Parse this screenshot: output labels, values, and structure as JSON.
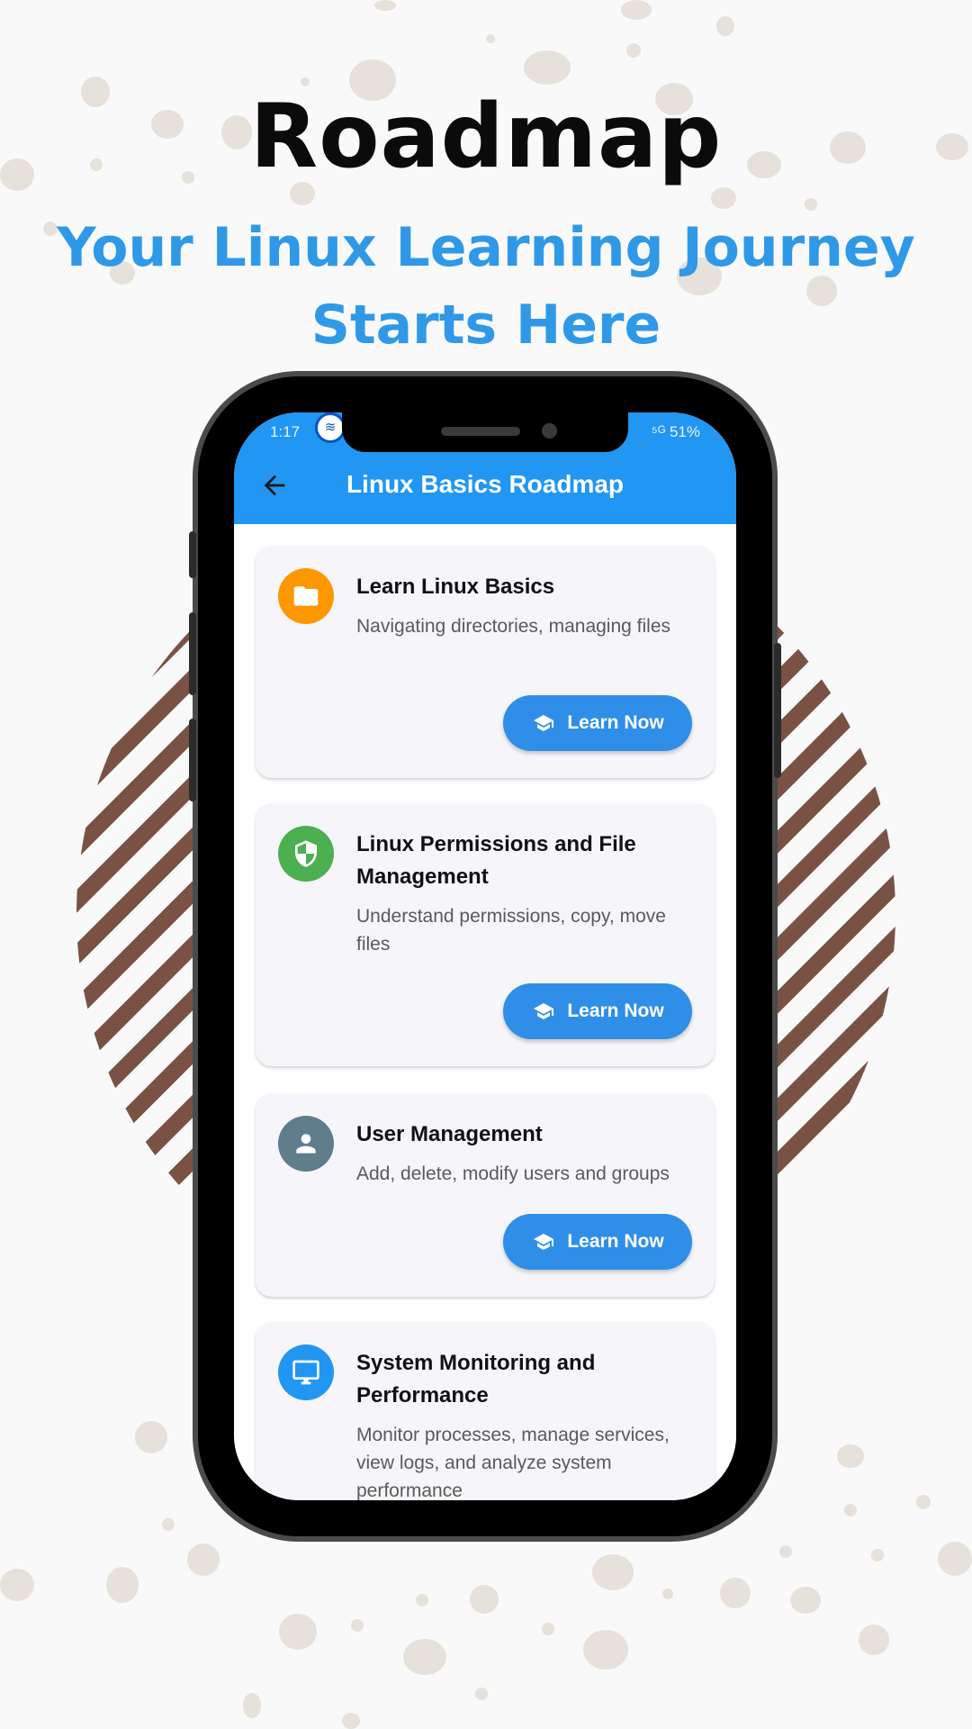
{
  "promo": {
    "title": "Roadmap",
    "subtitle": "Your Linux Learning Journey Starts Here"
  },
  "status_bar": {
    "time": "1:17",
    "right": "⁵ᴳ 51%"
  },
  "app_bar": {
    "title": "Linux Basics Roadmap"
  },
  "cards": [
    {
      "title": "Learn Linux Basics",
      "description": "Navigating directories, managing files",
      "button": "Learn Now",
      "icon": "folder-icon",
      "icon_color": "#ff9800"
    },
    {
      "title": "Linux Permissions and File Management",
      "description": "Understand permissions, copy, move files",
      "button": "Learn Now",
      "icon": "shield-icon",
      "icon_color": "#4caf50"
    },
    {
      "title": "User Management",
      "description": "Add, delete, modify users and groups",
      "button": "Learn Now",
      "icon": "person-icon",
      "icon_color": "#607d8b"
    },
    {
      "title": "System Monitoring and Performance",
      "description": "Monitor processes, manage services, view logs, and analyze system performance",
      "icon": "monitor-icon",
      "icon_color": "#2196f3"
    }
  ],
  "colors": {
    "primary": "#2196f3",
    "button": "#2f8fe8",
    "subtitle": "#2f99e8",
    "stripe": "#7a5244"
  }
}
